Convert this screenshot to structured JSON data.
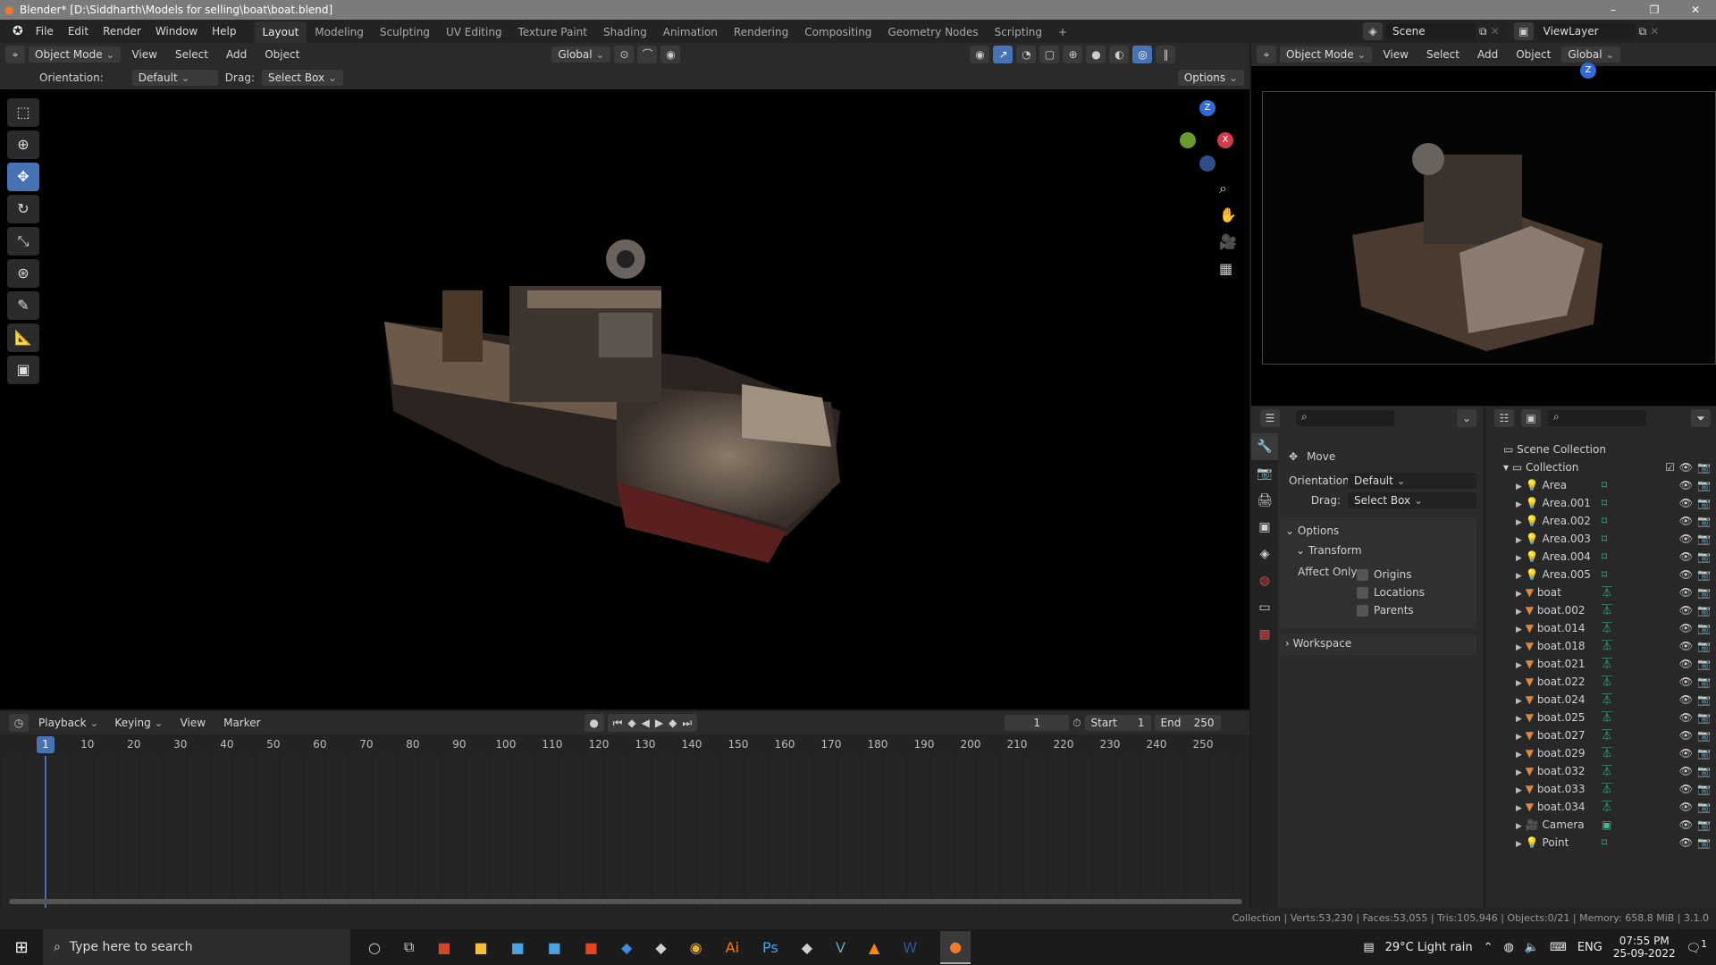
{
  "window": {
    "title": "Blender* [D:\\Siddharth\\Models for selling\\boat\\boat.blend]",
    "controls": [
      "–",
      "❐",
      "✕"
    ]
  },
  "menu": [
    "File",
    "Edit",
    "Render",
    "Window",
    "Help"
  ],
  "workspaces": [
    "Layout",
    "Modeling",
    "Sculpting",
    "UV Editing",
    "Texture Paint",
    "Shading",
    "Animation",
    "Rendering",
    "Compositing",
    "Geometry Nodes",
    "Scripting",
    "+"
  ],
  "scene": {
    "scene_name": "Scene",
    "view_layer": "ViewLayer"
  },
  "viewport_header": {
    "mode": "Object Mode",
    "menus": [
      "View",
      "Select",
      "Add",
      "Object"
    ],
    "orientation": "Global"
  },
  "tool_settings": {
    "orientation_label": "Orientation:",
    "orientation": "Default",
    "drag_label": "Drag:",
    "drag": "Select Box",
    "options": "Options"
  },
  "gizmo": {
    "x": "X",
    "y": "Y",
    "z": "Z"
  },
  "properties": {
    "tool": "Move",
    "orientation_label": "Orientation",
    "orientation": "Default",
    "drag_label": "Drag:",
    "drag": "Select Box",
    "options_panel": "Options",
    "transform_panel": "Transform",
    "affect_only": "Affect Only",
    "checks": [
      "Origins",
      "Locations",
      "Parents"
    ],
    "workspace_panel": "Workspace"
  },
  "outliner": {
    "scene_collection": "Scene Collection",
    "collection": "Collection",
    "items": [
      {
        "name": "Area",
        "type": "light"
      },
      {
        "name": "Area.001",
        "type": "light"
      },
      {
        "name": "Area.002",
        "type": "light"
      },
      {
        "name": "Area.003",
        "type": "light"
      },
      {
        "name": "Area.004",
        "type": "light"
      },
      {
        "name": "Area.005",
        "type": "light"
      },
      {
        "name": "boat",
        "type": "mesh"
      },
      {
        "name": "boat.002",
        "type": "mesh"
      },
      {
        "name": "boat.014",
        "type": "mesh"
      },
      {
        "name": "boat.018",
        "type": "mesh"
      },
      {
        "name": "boat.021",
        "type": "mesh"
      },
      {
        "name": "boat.022",
        "type": "mesh"
      },
      {
        "name": "boat.024",
        "type": "mesh"
      },
      {
        "name": "boat.025",
        "type": "mesh"
      },
      {
        "name": "boat.027",
        "type": "mesh"
      },
      {
        "name": "boat.029",
        "type": "mesh"
      },
      {
        "name": "boat.032",
        "type": "mesh"
      },
      {
        "name": "boat.033",
        "type": "mesh"
      },
      {
        "name": "boat.034",
        "type": "mesh"
      },
      {
        "name": "Camera",
        "type": "camera"
      },
      {
        "name": "Point",
        "type": "light"
      }
    ]
  },
  "timeline": {
    "menus": [
      "Playback",
      "Keying",
      "View",
      "Marker"
    ],
    "current_frame": "1",
    "start_label": "Start",
    "start": "1",
    "end_label": "End",
    "end": "250",
    "ticks": [
      10,
      20,
      30,
      40,
      50,
      60,
      70,
      80,
      90,
      100,
      110,
      120,
      130,
      140,
      150,
      160,
      170,
      180,
      190,
      200,
      210,
      220,
      230,
      240,
      250
    ]
  },
  "status": "Collection | Verts:53,230 | Faces:53,055 | Tris:105,946 | Objects:0/21 | Memory: 658.8 MiB | 3.1.0",
  "taskbar": {
    "search_placeholder": "Type here to search",
    "weather": "29°C  Light rain",
    "lang": "ENG",
    "time": "07:55 PM",
    "date": "25-09-2022",
    "notif": "1"
  },
  "colors": {
    "accent": "#4772b3",
    "object": "#e0883c",
    "data": "#3fbf91"
  }
}
